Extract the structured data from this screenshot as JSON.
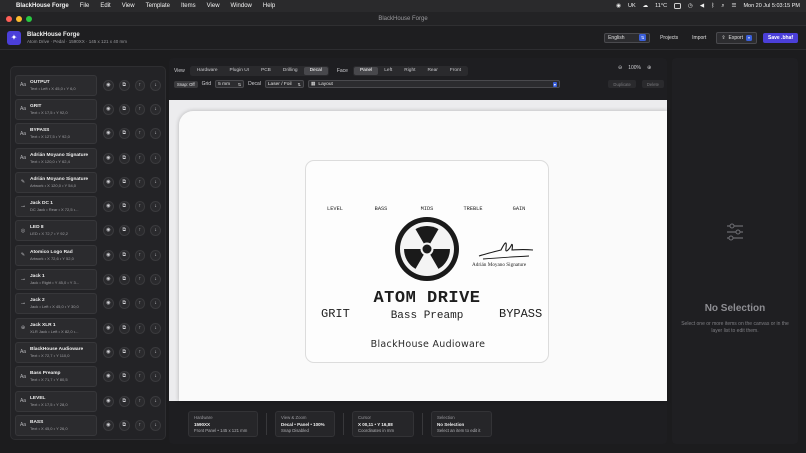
{
  "menubar": {
    "app": "BlackHouse Forge",
    "items": [
      "File",
      "Edit",
      "View",
      "Template",
      "Items",
      "View",
      "Window",
      "Help"
    ],
    "status": {
      "lang": "UK",
      "temp": "11°C",
      "clock": "Mon 20 Jul  5:03:15 PM"
    }
  },
  "window": {
    "title": "BlackHouse Forge"
  },
  "header": {
    "app_name": "BlackHouse Forge",
    "subtitle": "Atom Drive · Pedal · 1590XX · 145 x 121 x 40 mm",
    "language": "English",
    "projects": "Projects",
    "import": "Import",
    "export": "Export",
    "save": "Save .bhaf"
  },
  "layers": [
    {
      "icon": "text",
      "title": "OUTPUT",
      "detail": "Text • Left • X 45,0 • Y 6,0"
    },
    {
      "icon": "text",
      "title": "GRIT",
      "detail": "Text • X 17,5 • Y 92,0"
    },
    {
      "icon": "text",
      "title": "BYPASS",
      "detail": "Text • X 127,5 • Y 92,0"
    },
    {
      "icon": "text",
      "title": "Adrián Moyano Signature",
      "detail": "Text • X 120,0 • Y 62,4"
    },
    {
      "icon": "artwork",
      "title": "Adrián Moyano Signature",
      "detail": "Artwork • X 120,0 • Y 54,0"
    },
    {
      "icon": "jack",
      "title": "Jack DC 1",
      "detail": "DC Jack • Rear • X 72,5 •..."
    },
    {
      "icon": "led",
      "title": "LED 8",
      "detail": "LED • X 72,7 • Y 92,2"
    },
    {
      "icon": "artwork",
      "title": "Atomico Logo Rad",
      "detail": "Artwork • X 72,6 • Y 52,0"
    },
    {
      "icon": "jack",
      "title": "Jack 1",
      "detail": "Jack • Right • Y 45,0 • Y 3..."
    },
    {
      "icon": "jack",
      "title": "Jack 2",
      "detail": "Jack • Left • X 45,0 • Y 30,0"
    },
    {
      "icon": "xlr",
      "title": "Jack XLR 1",
      "detail": "XLR Jack • Left • X 82,0 •..."
    },
    {
      "icon": "text",
      "title": "BlackHouse Audioware",
      "detail": "Text • X 72,7 • Y 110,0"
    },
    {
      "icon": "text",
      "title": "Bass Preamp",
      "detail": "Text • X 71,7 • Y 80,5"
    },
    {
      "icon": "text",
      "title": "LEVEL",
      "detail": "Text • X 17,5 • Y 28,0"
    },
    {
      "icon": "text",
      "title": "BASS",
      "detail": "Text • X 45,0 • Y 26,0"
    }
  ],
  "viewbar": {
    "view_label": "View",
    "views": [
      "Hardware",
      "Plugin UI",
      "PCB",
      "Drilling",
      "Decal"
    ],
    "active_view": "Decal",
    "face_label": "Face",
    "faces": [
      "Panel",
      "Left",
      "Right",
      "Rear",
      "Front"
    ],
    "active_face": "Panel",
    "zoom": "100%"
  },
  "toolbar": {
    "snap": "Snap: Off",
    "grid_label": "Grid",
    "grid_value": "5 mm",
    "decal_label": "Decal",
    "decal_value": "Laser / Foil",
    "layout_value": "Layout",
    "duplicate": "Duplicate",
    "delete": "Delete"
  },
  "pedal": {
    "knobs": [
      "LEVEL",
      "BASS",
      "MIDS",
      "TREBLE",
      "GAIN"
    ],
    "signature": "Adrián Moyano Signature",
    "title": "ATOM DRIVE",
    "subtitle": "Bass Preamp",
    "left_switch": "GRIT",
    "right_switch": "BYPASS",
    "brand": "BlackHouse Audioware"
  },
  "statusbar": [
    {
      "head": "Hardware",
      "value": "1590XX",
      "value2": "Front Panel • 145 x 121 mm"
    },
    {
      "head": "View & Zoom",
      "value": "Decal • Panel • 100%",
      "value2": "Snap Disabled"
    },
    {
      "head": "Cursor",
      "value": "X 00,11 • Y 16,88",
      "value2": "Coordinates in mm"
    },
    {
      "head": "Selection",
      "value": "No Selection",
      "value2": "Select an item to edit it"
    }
  ],
  "inspector": {
    "heading": "No Selection",
    "hint": "Select one or more items on the canvas or in the layer list to edit them."
  },
  "colors": {
    "accent": "#4b3fd9",
    "background": "#1c1c1e"
  }
}
